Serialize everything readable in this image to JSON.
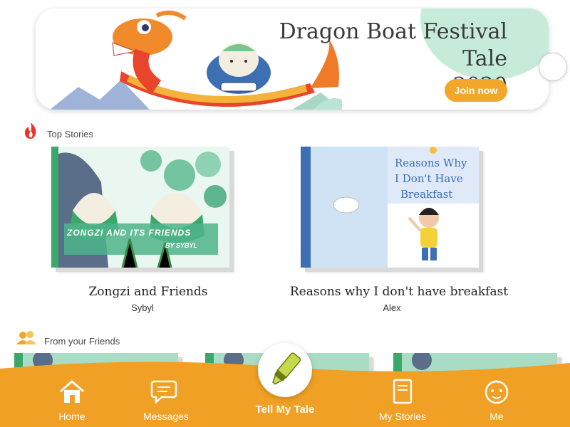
{
  "banner": {
    "title_line1": "Dragon Boat Festival Tale",
    "title_line2": "2020",
    "join_label": "Join now"
  },
  "sections": {
    "top_stories": "Top Stories",
    "from_friends": "From your Friends"
  },
  "top_stories": [
    {
      "title": "Zongzi and Friends",
      "author": "Sybyl",
      "cover_text": "ZONGZI AND ITS FRIENDS",
      "cover_byline": "BY SYBYL"
    },
    {
      "title": "Reasons why I don't have breakfast",
      "author": "Alex",
      "cover_text_1": "Reasons Why",
      "cover_text_2": "I Don't Have",
      "cover_text_3": "Breakfast"
    }
  ],
  "tabbar": {
    "home": "Home",
    "messages": "Messages",
    "tell_my_tale": "Tell My Tale",
    "my_stories": "My Stories",
    "me": "Me"
  },
  "colors": {
    "accent": "#f2a72b",
    "tabbar": "#f0a024",
    "mint": "#c6ecd9"
  },
  "icons": [
    "fire-icon",
    "friends-icon",
    "home-icon",
    "messages-icon",
    "highlighter-icon",
    "book-icon",
    "baby-face-icon"
  ]
}
